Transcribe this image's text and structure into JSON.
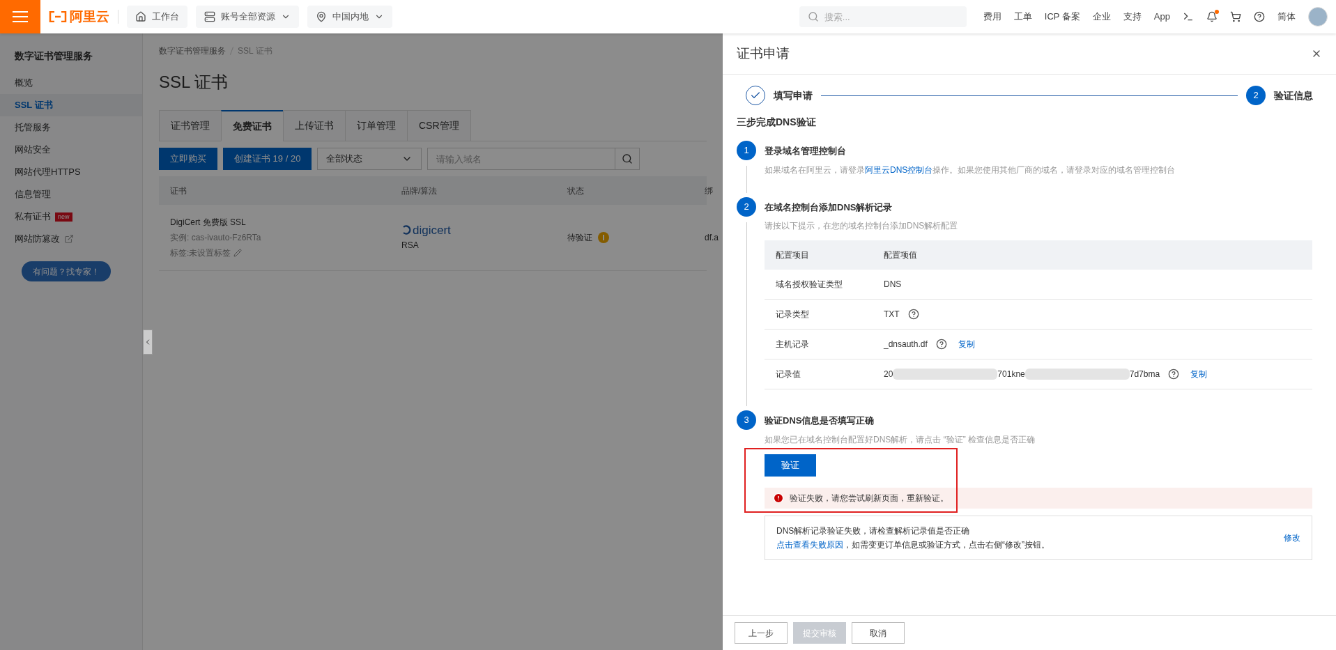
{
  "topbar": {
    "brand": "阿里云",
    "nav": [
      {
        "label": "工作台",
        "kind": "home",
        "dropdown": false
      },
      {
        "label": "账号全部资源",
        "kind": "stack",
        "dropdown": true
      },
      {
        "label": "中国内地",
        "kind": "pin",
        "dropdown": true
      }
    ],
    "search": {
      "placeholder": "搜索..."
    },
    "links": [
      "费用",
      "工单",
      "ICP 备案",
      "企业",
      "支持",
      "App"
    ],
    "notification": {
      "unread": true
    },
    "language": "简体"
  },
  "sidebar": {
    "title": "数字证书管理服务",
    "items": [
      {
        "label": "概览",
        "selected": false
      },
      {
        "label": "SSL 证书",
        "selected": true
      },
      {
        "label": "托管服务",
        "selected": false
      },
      {
        "label": "网站安全",
        "selected": false
      },
      {
        "label": "网站代理HTTPS",
        "selected": false
      },
      {
        "label": "信息管理",
        "selected": false
      },
      {
        "label": "私有证书",
        "selected": false,
        "badge": "new"
      },
      {
        "label": "网站防篡改",
        "selected": false,
        "external": true
      }
    ],
    "help_button": "有问题？找专家！"
  },
  "breadcrumb": [
    "数字证书管理服务",
    "SSL 证书"
  ],
  "page_title": "SSL 证书",
  "tabs": [
    {
      "label": "证书管理",
      "selected": false
    },
    {
      "label": "免费证书",
      "selected": true
    },
    {
      "label": "上传证书",
      "selected": false
    },
    {
      "label": "订单管理",
      "selected": false
    },
    {
      "label": "CSR管理",
      "selected": false
    }
  ],
  "toolbar": {
    "buttons": [
      "立即购买",
      "创建证书 19 / 20"
    ],
    "status_select": "全部状态",
    "search": {
      "placeholder": "请输入域名"
    }
  },
  "table": {
    "columns": [
      "证书",
      "品牌/算法",
      "状态",
      "绑"
    ],
    "rows": [
      {
        "name": "DigiCert 免费版 SSL",
        "instance": "实例: cas-ivauto-Fz6RTa",
        "tags": "标签:未设置标签",
        "brand": "digicert",
        "algorithm": "RSA",
        "status": "待验证",
        "warning": true,
        "column_4": "df.a"
      }
    ]
  },
  "drawer": {
    "title": "证书申请",
    "steps": [
      {
        "label": "填写申请",
        "done": true
      },
      {
        "label": "验证信息",
        "number": "2",
        "done": false
      }
    ],
    "heading": "三步完成DNS验证",
    "sections": [
      {
        "number": "1",
        "title": "登录域名管理控制台",
        "description": {
          "before": "如果域名在阿里云，请登录",
          "link": "阿里云DNS控制台",
          "after": "操作。如果您使用其他厂商的域名，请登录对应的域名管理控制台"
        }
      },
      {
        "number": "2",
        "title": "在域名控制台添加DNS解析记录",
        "description": {
          "before": "请按以下提示，在您的域名控制台添加DNS解析配置"
        },
        "config_table": {
          "columns": [
            "配置项目",
            "配置项值"
          ],
          "rows": [
            {
              "label": "域名授权验证类型",
              "value_parts": [
                "DNS"
              ],
              "help": false
            },
            {
              "label": "记录类型",
              "value_parts": [
                "TXT"
              ],
              "help": true
            },
            {
              "label": "主机记录",
              "value_parts": [
                "_dnsauth.df"
              ],
              "help": true,
              "copy": "复制"
            },
            {
              "label": "记录值",
              "value_parts": [
                "20",
                "701kne",
                "7d7bma"
              ],
              "help": true,
              "copy": "复制"
            }
          ]
        }
      },
      {
        "number": "3",
        "title": "验证DNS信息是否填写正确",
        "description": {
          "before": "如果您已在域名控制台配置好DNS解析，请点击 “验证” 检查信息是否正确"
        },
        "verify_button": "验证",
        "error": "验证失败，请您尝试刷新页面，重新验证。",
        "notice": {
          "line1": "DNS解析记录验证失败，请检查解析记录值是否正确",
          "link": "点击查看失败原因",
          "line2": "，如需变更订单信息或验证方式，点击右侧“修改”按钮。",
          "action": "修改"
        }
      }
    ],
    "footer": [
      {
        "label": "上一步",
        "disabled": false
      },
      {
        "label": "提交审核",
        "disabled": true
      },
      {
        "label": "取消",
        "disabled": false
      }
    ]
  }
}
